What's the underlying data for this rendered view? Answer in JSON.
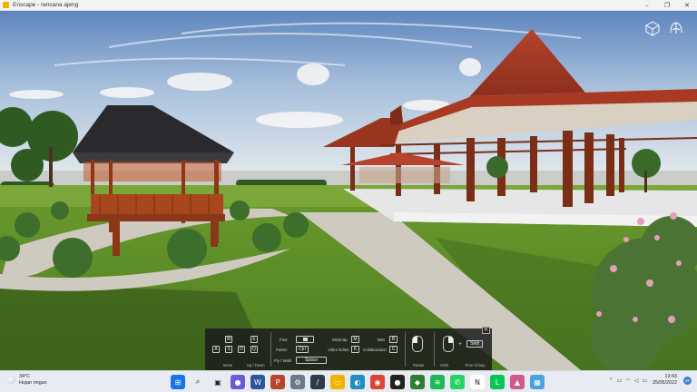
{
  "window": {
    "title": "Enscape - rencana ajeng",
    "controls": [
      "–",
      "❐",
      "✕"
    ]
  },
  "viewport": {
    "icons": [
      "cube-view-icon",
      "leaf-icon"
    ]
  },
  "controls_overlay": {
    "move": {
      "keys_top": [
        "W"
      ],
      "keys_bottom": [
        "A",
        "S",
        "D"
      ],
      "label": "Move"
    },
    "updown": {
      "keys": [
        "E",
        "Q"
      ],
      "label": "Up / Down"
    },
    "fast": {
      "label": "Fast",
      "key": ""
    },
    "faster": {
      "label": "Faster",
      "key": "Ctrl"
    },
    "flywalk": {
      "label": "Fly / Walk",
      "key": "Space"
    },
    "minimap": {
      "label": "Minimap",
      "key": "M"
    },
    "video_editor": {
      "label": "Video Editor",
      "key": "K"
    },
    "bim": {
      "label": "BIM",
      "key": "B"
    },
    "collaboration": {
      "label": "Collaboration",
      "key": "C"
    },
    "rotate": {
      "label": "Rotate"
    },
    "orbit": {
      "label": "Orbit",
      "plus": "+",
      "key": "Shift"
    },
    "time_of_day": {
      "label": "Time of Day"
    },
    "toggle_key": "H"
  },
  "taskbar": {
    "weather": {
      "temp": "34°C",
      "desc": "Hujan ringan"
    },
    "apps": [
      {
        "name": "windows-start-icon",
        "color": "#1a73e8",
        "glyph": "⊞"
      },
      {
        "name": "search-icon",
        "color": "#e8ecf2",
        "glyph": "⌕"
      },
      {
        "name": "task-view-icon",
        "color": "#e8ecf2",
        "glyph": "▣"
      },
      {
        "name": "chat-icon",
        "color": "#6b5cd6",
        "glyph": "●"
      },
      {
        "name": "word-icon",
        "color": "#2b579a",
        "glyph": "W"
      },
      {
        "name": "powerpoint-icon",
        "color": "#b7472a",
        "glyph": "P"
      },
      {
        "name": "settings-icon",
        "color": "#6c7a89",
        "glyph": "⚙"
      },
      {
        "name": "script-icon",
        "color": "#2d3a4a",
        "glyph": "/"
      },
      {
        "name": "file-explorer-icon",
        "color": "#f0b400",
        "glyph": "▭"
      },
      {
        "name": "edge-icon",
        "color": "#1f8fbf",
        "glyph": "◐"
      },
      {
        "name": "chrome-icon",
        "color": "#db4437",
        "glyph": "◉"
      },
      {
        "name": "github-icon",
        "color": "#222222",
        "glyph": "●"
      },
      {
        "name": "sketchup-icon",
        "color": "#2e7d32",
        "glyph": "◆"
      },
      {
        "name": "spotify-icon",
        "color": "#1db954",
        "glyph": "≋"
      },
      {
        "name": "whatsapp-icon",
        "color": "#25d366",
        "glyph": "✆"
      },
      {
        "name": "notion-icon",
        "color": "#ffffff",
        "glyph": "N"
      },
      {
        "name": "line-icon",
        "color": "#06c755",
        "glyph": "L"
      },
      {
        "name": "photos-icon",
        "color": "#d05a8a",
        "glyph": "▲"
      },
      {
        "name": "app-icon",
        "color": "#4aa3df",
        "glyph": "▦"
      }
    ],
    "tray_icons": [
      "chevron-up-icon",
      "ime-icon",
      "wifi-icon",
      "volume-icon",
      "battery-icon"
    ],
    "time": "13:43",
    "date": "25/05/2022",
    "notification_count": "20"
  }
}
